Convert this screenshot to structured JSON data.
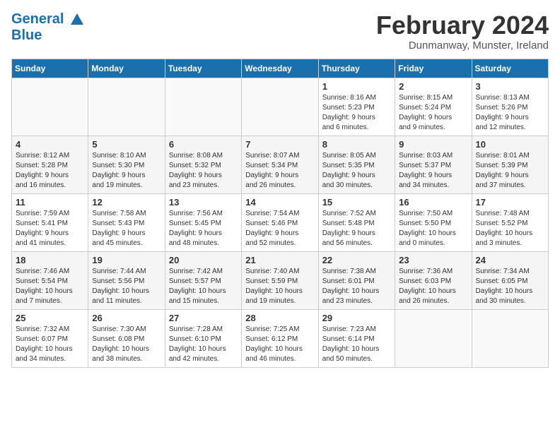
{
  "header": {
    "logo_line1": "General",
    "logo_line2": "Blue",
    "month": "February 2024",
    "location": "Dunmanway, Munster, Ireland"
  },
  "days_of_week": [
    "Sunday",
    "Monday",
    "Tuesday",
    "Wednesday",
    "Thursday",
    "Friday",
    "Saturday"
  ],
  "weeks": [
    [
      {
        "day": "",
        "info": ""
      },
      {
        "day": "",
        "info": ""
      },
      {
        "day": "",
        "info": ""
      },
      {
        "day": "",
        "info": ""
      },
      {
        "day": "1",
        "info": "Sunrise: 8:16 AM\nSunset: 5:23 PM\nDaylight: 9 hours\nand 6 minutes."
      },
      {
        "day": "2",
        "info": "Sunrise: 8:15 AM\nSunset: 5:24 PM\nDaylight: 9 hours\nand 9 minutes."
      },
      {
        "day": "3",
        "info": "Sunrise: 8:13 AM\nSunset: 5:26 PM\nDaylight: 9 hours\nand 12 minutes."
      }
    ],
    [
      {
        "day": "4",
        "info": "Sunrise: 8:12 AM\nSunset: 5:28 PM\nDaylight: 9 hours\nand 16 minutes."
      },
      {
        "day": "5",
        "info": "Sunrise: 8:10 AM\nSunset: 5:30 PM\nDaylight: 9 hours\nand 19 minutes."
      },
      {
        "day": "6",
        "info": "Sunrise: 8:08 AM\nSunset: 5:32 PM\nDaylight: 9 hours\nand 23 minutes."
      },
      {
        "day": "7",
        "info": "Sunrise: 8:07 AM\nSunset: 5:34 PM\nDaylight: 9 hours\nand 26 minutes."
      },
      {
        "day": "8",
        "info": "Sunrise: 8:05 AM\nSunset: 5:35 PM\nDaylight: 9 hours\nand 30 minutes."
      },
      {
        "day": "9",
        "info": "Sunrise: 8:03 AM\nSunset: 5:37 PM\nDaylight: 9 hours\nand 34 minutes."
      },
      {
        "day": "10",
        "info": "Sunrise: 8:01 AM\nSunset: 5:39 PM\nDaylight: 9 hours\nand 37 minutes."
      }
    ],
    [
      {
        "day": "11",
        "info": "Sunrise: 7:59 AM\nSunset: 5:41 PM\nDaylight: 9 hours\nand 41 minutes."
      },
      {
        "day": "12",
        "info": "Sunrise: 7:58 AM\nSunset: 5:43 PM\nDaylight: 9 hours\nand 45 minutes."
      },
      {
        "day": "13",
        "info": "Sunrise: 7:56 AM\nSunset: 5:45 PM\nDaylight: 9 hours\nand 48 minutes."
      },
      {
        "day": "14",
        "info": "Sunrise: 7:54 AM\nSunset: 5:46 PM\nDaylight: 9 hours\nand 52 minutes."
      },
      {
        "day": "15",
        "info": "Sunrise: 7:52 AM\nSunset: 5:48 PM\nDaylight: 9 hours\nand 56 minutes."
      },
      {
        "day": "16",
        "info": "Sunrise: 7:50 AM\nSunset: 5:50 PM\nDaylight: 10 hours\nand 0 minutes."
      },
      {
        "day": "17",
        "info": "Sunrise: 7:48 AM\nSunset: 5:52 PM\nDaylight: 10 hours\nand 3 minutes."
      }
    ],
    [
      {
        "day": "18",
        "info": "Sunrise: 7:46 AM\nSunset: 5:54 PM\nDaylight: 10 hours\nand 7 minutes."
      },
      {
        "day": "19",
        "info": "Sunrise: 7:44 AM\nSunset: 5:56 PM\nDaylight: 10 hours\nand 11 minutes."
      },
      {
        "day": "20",
        "info": "Sunrise: 7:42 AM\nSunset: 5:57 PM\nDaylight: 10 hours\nand 15 minutes."
      },
      {
        "day": "21",
        "info": "Sunrise: 7:40 AM\nSunset: 5:59 PM\nDaylight: 10 hours\nand 19 minutes."
      },
      {
        "day": "22",
        "info": "Sunrise: 7:38 AM\nSunset: 6:01 PM\nDaylight: 10 hours\nand 23 minutes."
      },
      {
        "day": "23",
        "info": "Sunrise: 7:36 AM\nSunset: 6:03 PM\nDaylight: 10 hours\nand 26 minutes."
      },
      {
        "day": "24",
        "info": "Sunrise: 7:34 AM\nSunset: 6:05 PM\nDaylight: 10 hours\nand 30 minutes."
      }
    ],
    [
      {
        "day": "25",
        "info": "Sunrise: 7:32 AM\nSunset: 6:07 PM\nDaylight: 10 hours\nand 34 minutes."
      },
      {
        "day": "26",
        "info": "Sunrise: 7:30 AM\nSunset: 6:08 PM\nDaylight: 10 hours\nand 38 minutes."
      },
      {
        "day": "27",
        "info": "Sunrise: 7:28 AM\nSunset: 6:10 PM\nDaylight: 10 hours\nand 42 minutes."
      },
      {
        "day": "28",
        "info": "Sunrise: 7:25 AM\nSunset: 6:12 PM\nDaylight: 10 hours\nand 46 minutes."
      },
      {
        "day": "29",
        "info": "Sunrise: 7:23 AM\nSunset: 6:14 PM\nDaylight: 10 hours\nand 50 minutes."
      },
      {
        "day": "",
        "info": ""
      },
      {
        "day": "",
        "info": ""
      }
    ]
  ]
}
